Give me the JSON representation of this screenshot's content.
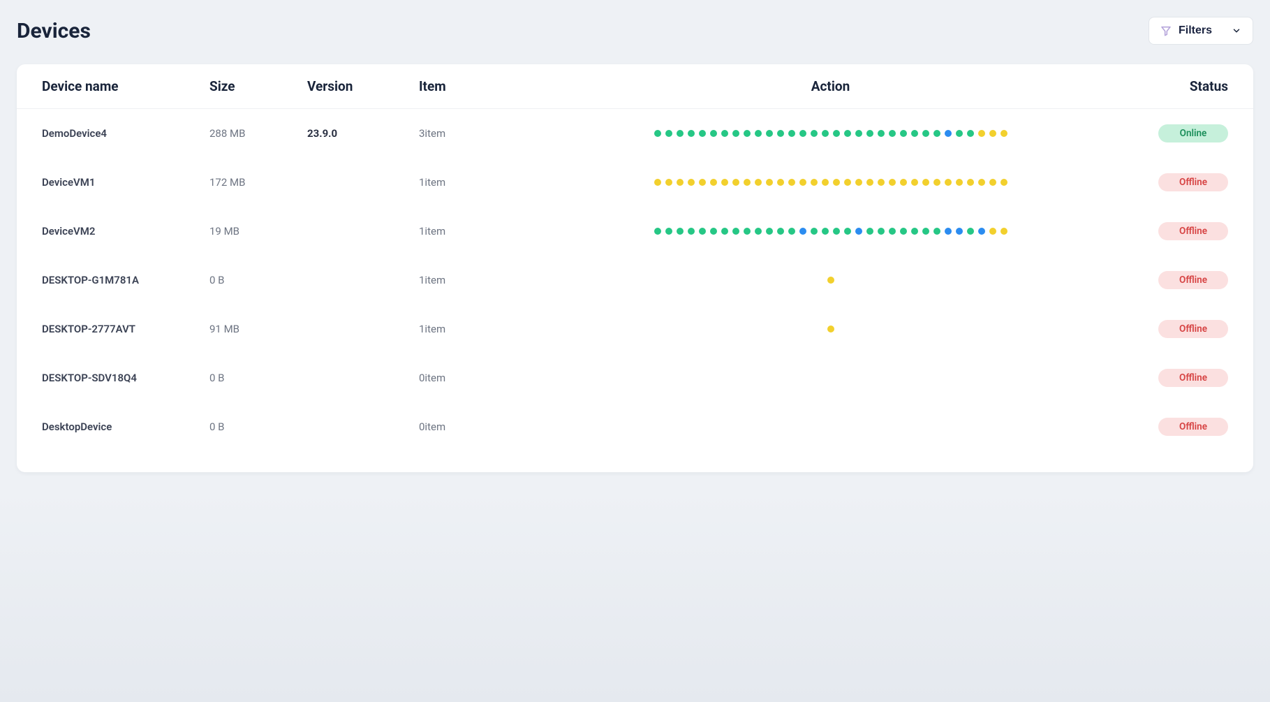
{
  "page": {
    "title": "Devices",
    "filters_label": "Filters"
  },
  "table": {
    "headers": {
      "name": "Device name",
      "size": "Size",
      "version": "Version",
      "item": "Item",
      "action": "Action",
      "status": "Status"
    },
    "status_labels": {
      "online": "Online",
      "offline": "Offline"
    },
    "dot_colors": {
      "g": "#26c785",
      "y": "#f2d02d",
      "b": "#2b8cf0"
    },
    "rows": [
      {
        "name": "DemoDevice4",
        "size": "288 MB",
        "version": "23.9.0",
        "item": "3item",
        "status": "online",
        "actions": [
          "g",
          "g",
          "g",
          "g",
          "g",
          "g",
          "g",
          "g",
          "g",
          "g",
          "g",
          "g",
          "g",
          "g",
          "g",
          "g",
          "g",
          "g",
          "g",
          "g",
          "g",
          "g",
          "g",
          "g",
          "g",
          "g",
          "b",
          "g",
          "g",
          "y",
          "y",
          "y"
        ]
      },
      {
        "name": "DeviceVM1",
        "size": "172 MB",
        "version": "",
        "item": "1item",
        "status": "offline",
        "actions": [
          "y",
          "y",
          "y",
          "y",
          "y",
          "y",
          "y",
          "y",
          "y",
          "y",
          "y",
          "y",
          "y",
          "y",
          "y",
          "y",
          "y",
          "y",
          "y",
          "y",
          "y",
          "y",
          "y",
          "y",
          "y",
          "y",
          "y",
          "y",
          "y",
          "y",
          "y",
          "y"
        ]
      },
      {
        "name": "DeviceVM2",
        "size": "19 MB",
        "version": "",
        "item": "1item",
        "status": "offline",
        "actions": [
          "g",
          "g",
          "g",
          "g",
          "g",
          "g",
          "g",
          "g",
          "g",
          "g",
          "g",
          "g",
          "g",
          "b",
          "g",
          "g",
          "g",
          "g",
          "b",
          "g",
          "g",
          "g",
          "g",
          "g",
          "g",
          "g",
          "b",
          "b",
          "g",
          "b",
          "y",
          "y"
        ]
      },
      {
        "name": "DESKTOP-G1M781A",
        "size": "0 B",
        "version": "",
        "item": "1item",
        "status": "offline",
        "actions": [
          "y"
        ]
      },
      {
        "name": "DESKTOP-2777AVT",
        "size": "91 MB",
        "version": "",
        "item": "1item",
        "status": "offline",
        "actions": [
          "y"
        ]
      },
      {
        "name": "DESKTOP-SDV18Q4",
        "size": "0 B",
        "version": "",
        "item": "0item",
        "status": "offline",
        "actions": []
      },
      {
        "name": "DesktopDevice",
        "size": "0 B",
        "version": "",
        "item": "0item",
        "status": "offline",
        "actions": []
      }
    ]
  }
}
